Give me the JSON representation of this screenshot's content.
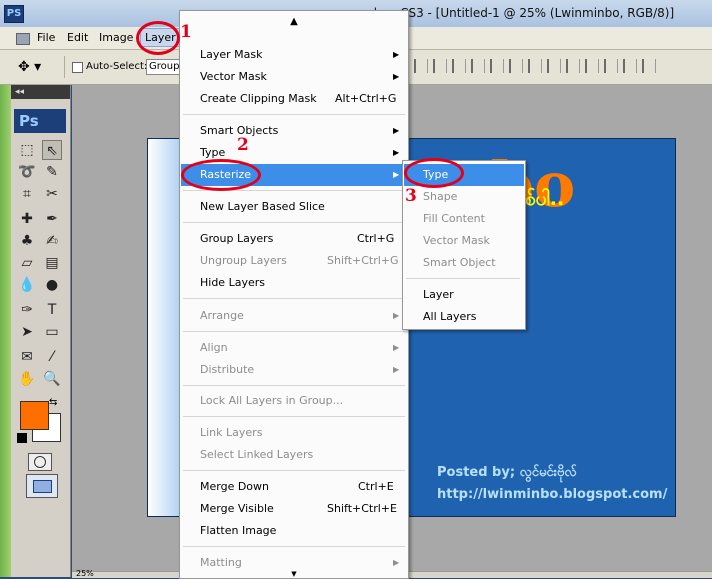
{
  "window": {
    "title": "...shop CS3 - [Untitled-1 @ 25% (Lwinminbo, RGB/8)]",
    "app_icon": "PS"
  },
  "menubar": {
    "items": [
      "File",
      "Edit",
      "Image",
      "Layer"
    ]
  },
  "options": {
    "auto_select_label": "Auto-Select:",
    "group_value": "Group"
  },
  "toolbox": {
    "header": "◂◂",
    "logo": "Ps",
    "foreground_color": "#ff6f00",
    "background_color": "#ffffff"
  },
  "canvas": {
    "big_text": "mnbo",
    "burmese_text": "ဒီမှာကလစ်ပါ..",
    "posted_by": "Posted by; လွင်မင်းဗိုလ်",
    "url": "http://lwinminbo.blogspot.com/",
    "background_color": "#1f63b0"
  },
  "status": {
    "zoom": "25%"
  },
  "layer_menu": {
    "scroll_up": "▲",
    "scroll_down": "▼",
    "items": [
      {
        "label": "Layer Mask",
        "shortcut": "",
        "submenu": true,
        "disabled": false
      },
      {
        "label": "Vector Mask",
        "shortcut": "",
        "submenu": true,
        "disabled": false
      },
      {
        "label": "Create Clipping Mask",
        "shortcut": "Alt+Ctrl+G",
        "submenu": false,
        "disabled": false
      },
      {
        "label": "Smart Objects",
        "shortcut": "",
        "submenu": true,
        "disabled": false
      },
      {
        "label": "Type",
        "shortcut": "",
        "submenu": true,
        "disabled": false
      },
      {
        "label": "Rasterize",
        "shortcut": "",
        "submenu": true,
        "disabled": false,
        "highlighted": true
      },
      {
        "label": "New Layer Based Slice",
        "shortcut": "",
        "submenu": false,
        "disabled": false
      },
      {
        "label": "Group Layers",
        "shortcut": "Ctrl+G",
        "submenu": false,
        "disabled": false
      },
      {
        "label": "Ungroup Layers",
        "shortcut": "Shift+Ctrl+G",
        "submenu": false,
        "disabled": true
      },
      {
        "label": "Hide Layers",
        "shortcut": "",
        "submenu": false,
        "disabled": false
      },
      {
        "label": "Arrange",
        "shortcut": "",
        "submenu": true,
        "disabled": true
      },
      {
        "label": "Align",
        "shortcut": "",
        "submenu": true,
        "disabled": true
      },
      {
        "label": "Distribute",
        "shortcut": "",
        "submenu": true,
        "disabled": true
      },
      {
        "label": "Lock All Layers in Group...",
        "shortcut": "",
        "submenu": false,
        "disabled": true
      },
      {
        "label": "Link Layers",
        "shortcut": "",
        "submenu": false,
        "disabled": true
      },
      {
        "label": "Select Linked Layers",
        "shortcut": "",
        "submenu": false,
        "disabled": true
      },
      {
        "label": "Merge Down",
        "shortcut": "Ctrl+E",
        "submenu": false,
        "disabled": false
      },
      {
        "label": "Merge Visible",
        "shortcut": "Shift+Ctrl+E",
        "submenu": false,
        "disabled": false
      },
      {
        "label": "Flatten Image",
        "shortcut": "",
        "submenu": false,
        "disabled": false
      },
      {
        "label": "Matting",
        "shortcut": "",
        "submenu": true,
        "disabled": true
      }
    ]
  },
  "rasterize_menu": {
    "items": [
      {
        "label": "Type",
        "disabled": false,
        "highlighted": true
      },
      {
        "label": "Shape",
        "disabled": true
      },
      {
        "label": "Fill Content",
        "disabled": true
      },
      {
        "label": "Vector Mask",
        "disabled": true
      },
      {
        "label": "Smart Object",
        "disabled": true
      },
      {
        "label": "Layer",
        "disabled": false
      },
      {
        "label": "All Layers",
        "disabled": false
      }
    ]
  },
  "annotations": {
    "step1": "1",
    "step2": "2",
    "step3": "3",
    "color": "#e3001b"
  }
}
